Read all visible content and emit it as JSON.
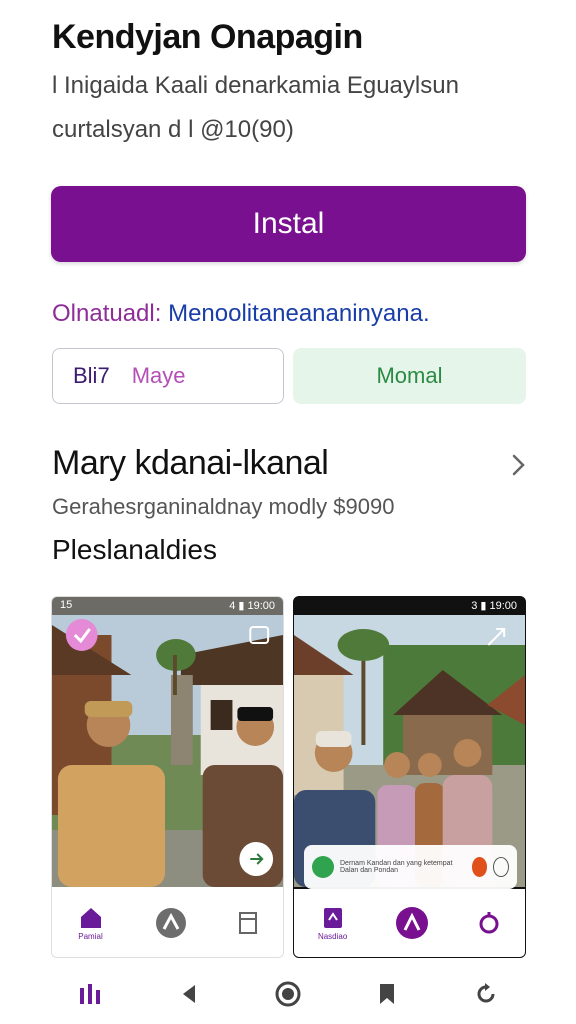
{
  "app": {
    "title": "Kendyjan Onapagin",
    "subtitle": "l Inigaida Kaali denarkamia Eguaylsun",
    "subtitle2": "curtalsyan d l @10(90)"
  },
  "install": {
    "label": "Instal"
  },
  "notice": {
    "lead": "Olnatuadl:",
    "text": " Menoolitaneananinyana."
  },
  "chips": [
    {
      "part1": "Bli7",
      "part2": "Maye"
    },
    {
      "label": "Momal"
    }
  ],
  "section": {
    "title": "Mary kdanai-lkanal",
    "subtitle": "Gerahesrganinaldnay modly $9090",
    "label": "Pleslanaldies"
  },
  "screens": [
    {
      "status_left": "15",
      "status_right": "4 ▮ 19:00",
      "tabs": [
        {
          "label": "Pamial",
          "icon": "home-icon"
        },
        {
          "label": "",
          "icon": "camera-icon"
        },
        {
          "label": "",
          "icon": "bookmark-icon"
        }
      ]
    },
    {
      "status_left": "",
      "status_right": "3 ▮ 19:00",
      "tabs": [
        {
          "label": "Nasdiao",
          "icon": "book-icon"
        },
        {
          "label": "",
          "icon": "edit-icon"
        },
        {
          "label": "",
          "icon": "search-icon"
        }
      ],
      "promo_text": "Dernam Kandan dan yang ketempat Dalan dan Pondan"
    }
  ],
  "colors": {
    "accent": "#79108f",
    "link": "#1a3ea8",
    "success_bg": "#e6f5ea",
    "success_text": "#2c8a45"
  }
}
